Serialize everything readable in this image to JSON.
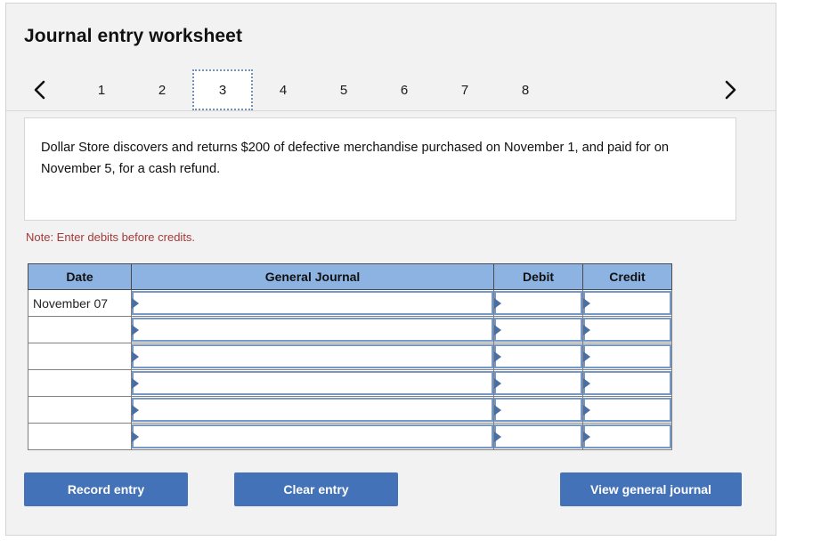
{
  "page": {
    "title": "Journal entry worksheet"
  },
  "nav": {
    "prev_icon": "chevron-left-icon",
    "next_icon": "chevron-right-icon",
    "tabs": [
      {
        "label": "1",
        "active": false
      },
      {
        "label": "2",
        "active": false
      },
      {
        "label": "3",
        "active": true
      },
      {
        "label": "4",
        "active": false
      },
      {
        "label": "5",
        "active": false
      },
      {
        "label": "6",
        "active": false
      },
      {
        "label": "7",
        "active": false
      },
      {
        "label": "8",
        "active": false
      }
    ]
  },
  "description": {
    "text": "Dollar Store discovers and returns $200 of defective merchandise purchased on November 1, and paid for on November 5, for a cash refund."
  },
  "note": {
    "text": "Note: Enter debits before credits."
  },
  "table": {
    "columns": [
      "Date",
      "General Journal",
      "Debit",
      "Credit"
    ],
    "rows": [
      {
        "date": "November 07",
        "general_journal": "",
        "debit": "",
        "credit": ""
      },
      {
        "date": "",
        "general_journal": "",
        "debit": "",
        "credit": ""
      },
      {
        "date": "",
        "general_journal": "",
        "debit": "",
        "credit": ""
      },
      {
        "date": "",
        "general_journal": "",
        "debit": "",
        "credit": ""
      },
      {
        "date": "",
        "general_journal": "",
        "debit": "",
        "credit": ""
      },
      {
        "date": "",
        "general_journal": "",
        "debit": "",
        "credit": ""
      }
    ]
  },
  "buttons": {
    "record": "Record entry",
    "clear": "Clear entry",
    "view": "View general journal"
  },
  "colors": {
    "panel_bg": "#f2f2f2",
    "header_blue": "#8db3e2",
    "button_blue": "#4472b8",
    "note_red": "#a33a3a",
    "field_border_blue": "#7698c8",
    "marker_blue": "#4a6fa5"
  }
}
